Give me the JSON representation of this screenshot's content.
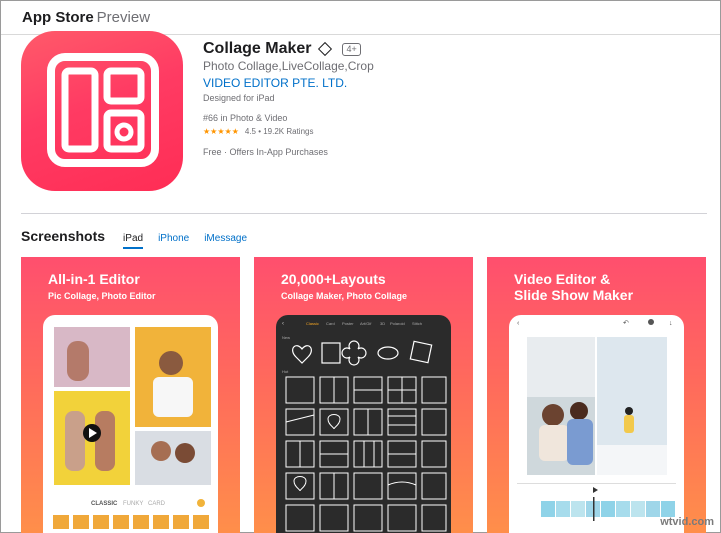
{
  "header": {
    "brand": "App Store",
    "section": "Preview"
  },
  "app": {
    "title": "Collage Maker",
    "age_rating": "4+",
    "subtitle": "Photo Collage,LiveCollage,Crop",
    "developer": "VIDEO EDITOR PTE. LTD.",
    "designed_for": "Designed for iPad",
    "rank": "#66 in Photo & Video",
    "stars": "★★★★★",
    "rating_text": "4.5 • 19.2K Ratings",
    "rating_value": 4.5,
    "price": "Free",
    "price_note": " · Offers In-App Purchases",
    "icon_color": "#ff3b63"
  },
  "screenshots": {
    "title": "Screenshots",
    "tabs": [
      {
        "label": "iPad",
        "active": true
      },
      {
        "label": "iPhone",
        "active": false
      },
      {
        "label": "iMessage",
        "active": false
      }
    ],
    "items": [
      {
        "caption": "All-in-1 Editor",
        "sub": "Pic Collage,  Photo Editor",
        "tabs": [
          "CLASSIC",
          "FUNKY",
          "CARD"
        ]
      },
      {
        "caption": "20,000+Layouts",
        "sub": "Collage Maker, Photo Collage",
        "tabs": [
          "Classic",
          "Card",
          "Poster",
          "Art/Gif",
          "3D",
          "Polaroid",
          "Stitch"
        ]
      },
      {
        "caption": "Video Editor  &",
        "caption2": "Slide Show Maker"
      }
    ]
  },
  "watermark": "wtvid.com"
}
